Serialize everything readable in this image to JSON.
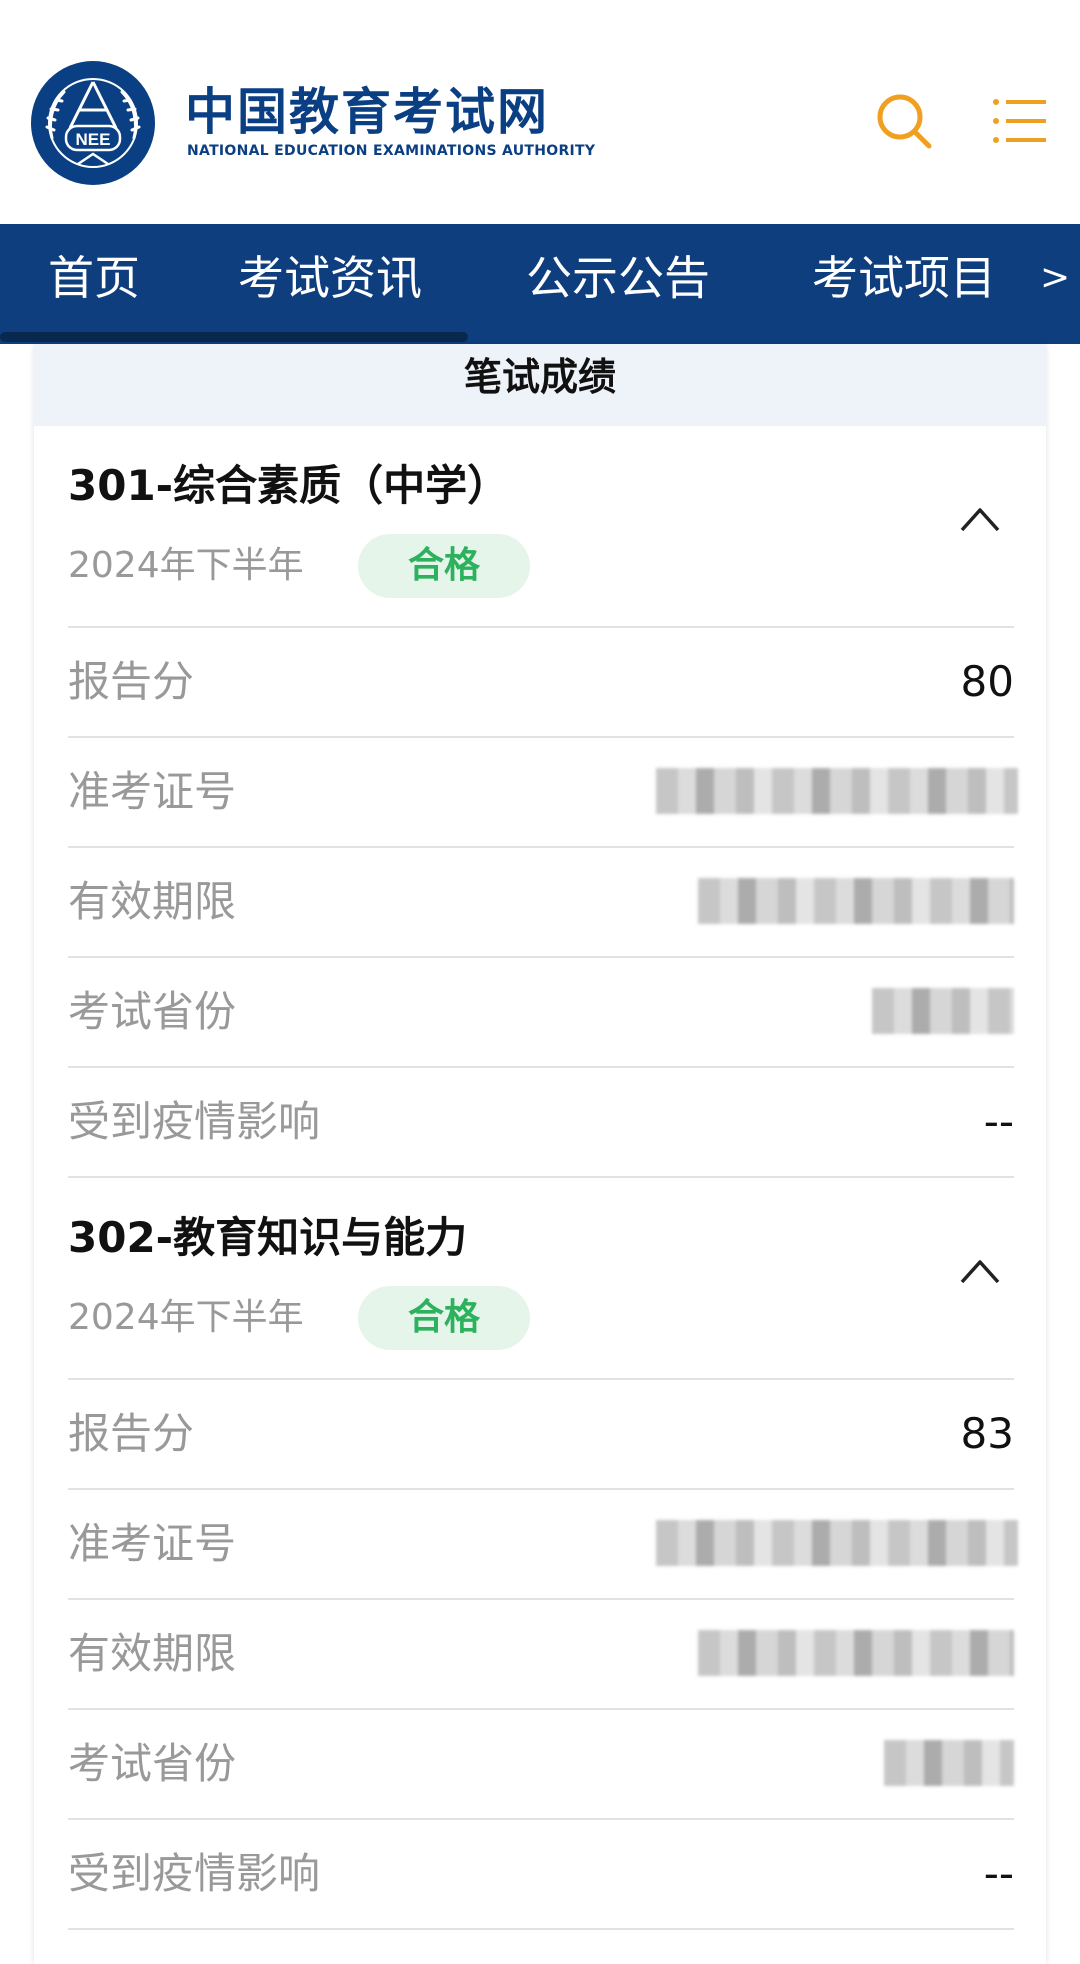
{
  "header": {
    "brand_cn": "中国教育考试网",
    "brand_en": "NATIONAL EDUCATION EXAMINATIONS AUTHORITY",
    "seal_text": "NEE",
    "brand_color": "#0b3f83",
    "icon_color": "#f0a020"
  },
  "nav": {
    "items": [
      {
        "label": "首页"
      },
      {
        "label": "考试资讯"
      },
      {
        "label": "公示公告"
      },
      {
        "label": "考试项目"
      }
    ],
    "more": ">",
    "color": "#0e3e7e"
  },
  "card": {
    "title": "笔试成绩",
    "subjects": [
      {
        "title": "301-综合素质（中学）",
        "term": "2024年下半年",
        "status": "合格",
        "rows": [
          {
            "label": "报告分",
            "value": "80"
          },
          {
            "label": "准考证号",
            "value": ""
          },
          {
            "label": "有效期限",
            "value": ""
          },
          {
            "label": "考试省份",
            "value": ""
          },
          {
            "label": "受到疫情影响",
            "value": "--"
          }
        ]
      },
      {
        "title": "302-教育知识与能力",
        "term": "2024年下半年",
        "status": "合格",
        "rows": [
          {
            "label": "报告分",
            "value": "83"
          },
          {
            "label": "准考证号",
            "value": ""
          },
          {
            "label": "有效期限",
            "value": ""
          },
          {
            "label": "考试省份",
            "value": ""
          },
          {
            "label": "受到疫情影响",
            "value": "--"
          }
        ]
      }
    ]
  },
  "icons": {
    "search": "search-icon",
    "menu": "menu-icon",
    "collapse": "chevron-up-icon",
    "logo": "nea-seal-logo"
  }
}
